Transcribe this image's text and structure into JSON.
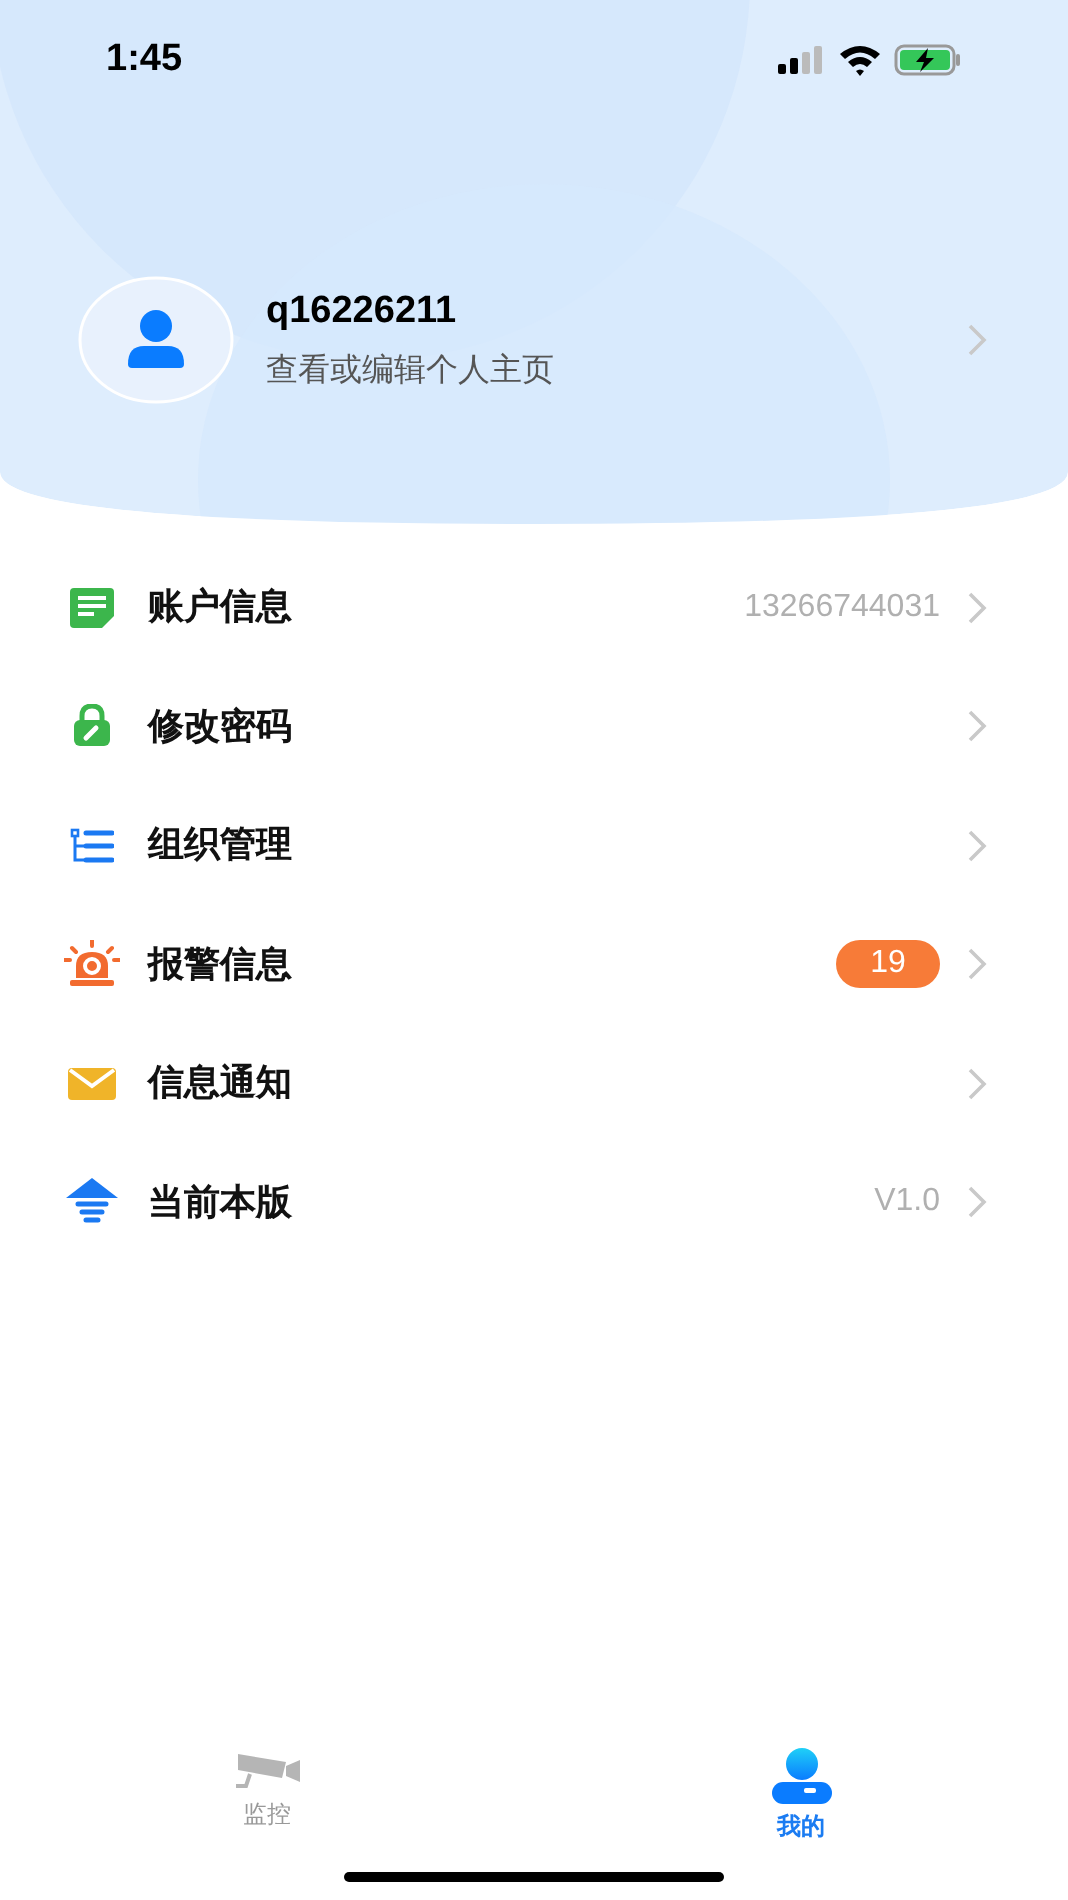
{
  "status_bar": {
    "time": "1:45"
  },
  "profile": {
    "username": "q16226211",
    "subtitle": "查看或编辑个人主页"
  },
  "menu": [
    {
      "kind": "account",
      "label": "账户信息",
      "value": "13266744031"
    },
    {
      "kind": "password",
      "label": "修改密码"
    },
    {
      "kind": "organization",
      "label": "组织管理"
    },
    {
      "kind": "alarm",
      "label": "报警信息",
      "badge": "19"
    },
    {
      "kind": "notice",
      "label": "信息通知"
    },
    {
      "kind": "version",
      "label": "当前本版",
      "value": "V1.0"
    }
  ],
  "tabs": [
    {
      "kind": "monitor",
      "label": "监控",
      "selected": false
    },
    {
      "kind": "mine",
      "label": "我的",
      "selected": true
    }
  ]
}
